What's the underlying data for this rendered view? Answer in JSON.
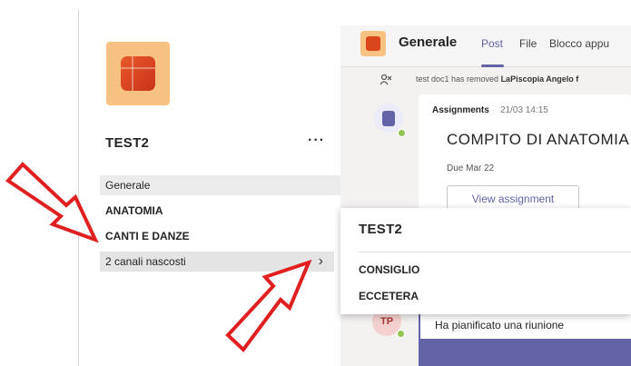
{
  "team": {
    "name": "TEST2",
    "more_icon": "more-options-icon",
    "more_glyph": "···"
  },
  "channels": {
    "general": "Generale",
    "anatomia": "ANATOMIA",
    "canti": "CANTI E DANZE",
    "hidden": "2 canali nascosti",
    "chevron_glyph": "›"
  },
  "header": {
    "title": "Generale",
    "tabs": [
      "Post",
      "File",
      "Blocco appu"
    ]
  },
  "system_message": {
    "actor": "test doc1",
    "text": " has removed ",
    "target": "LaPiscopia Angelo f"
  },
  "assignment_card": {
    "sender": "Assignments",
    "time": "21/03 14:15",
    "title": "COMPITO DI ANATOMIA",
    "due": "Due Mar 22",
    "button": "View assignment"
  },
  "meeting": {
    "avatar_initials": "TP",
    "text": "Ha pianificato una riunione"
  },
  "flyout": {
    "title": "TEST2",
    "items": [
      "CONSIGLIO",
      "ECCETERA"
    ]
  },
  "colors": {
    "accent": "#6264a7",
    "arrow": "#e02020",
    "team_tile": "#f6c181",
    "presence": "#92c353"
  }
}
